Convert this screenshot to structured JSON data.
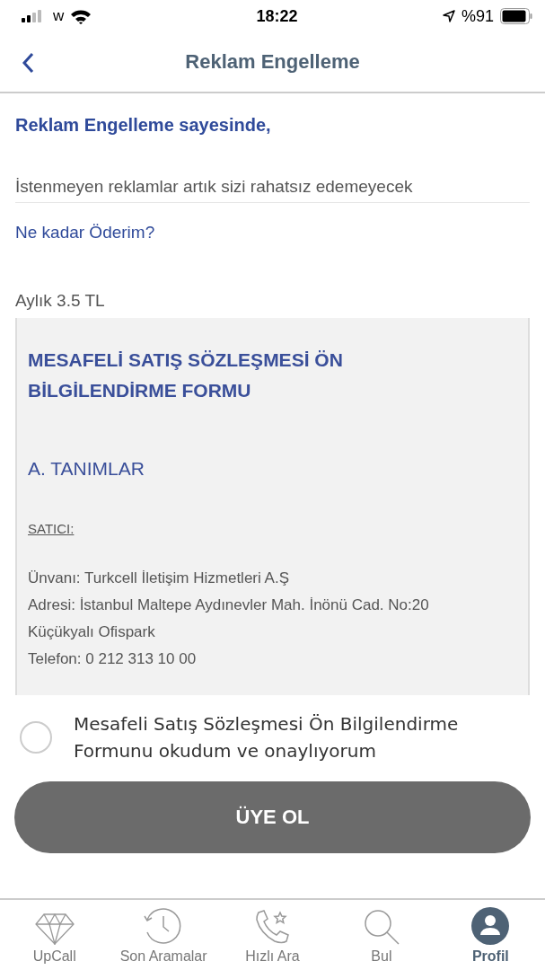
{
  "status_bar": {
    "carrier": "w",
    "time": "18:22",
    "battery": "%91"
  },
  "nav": {
    "title": "Reklam Engelleme"
  },
  "heading": "Reklam Engelleme sayesinde,",
  "description": "İstenmeyen reklamlar artık sizi rahatsız edemeyecek",
  "price_link": "Ne kadar Öderim?",
  "price": "Aylık 3.5 TL",
  "document": {
    "title": "MESAFELİ SATIŞ SÖZLEŞMESİ ÖN BİLGİLENDİRME FORMU",
    "section": "A. TANIMLAR",
    "label": "SATICI:",
    "lines": [
      "Ünvanı: Turkcell İletişim Hizmetleri A.Ş",
      "Adresi: İstanbul Maltepe Aydınevler Mah. İnönü Cad. No:20",
      "Küçükyalı Ofispark",
      "Telefon: 0 212 313 10 00"
    ]
  },
  "consent": {
    "label": "Mesafeli Satış Sözleşmesi Ön Bilgilendirme Formunu okudum ve onaylıyorum",
    "checked": false
  },
  "submit_button": {
    "label": "ÜYE OL",
    "disabled": true
  },
  "tab_bar": [
    {
      "label": "UpCall",
      "kind": "diamond",
      "selected": false
    },
    {
      "label": "Son Aramalar",
      "kind": "history",
      "selected": false
    },
    {
      "label": "Hızlı Ara",
      "kind": "phone",
      "selected": false
    },
    {
      "label": "Bul",
      "kind": "search",
      "selected": false
    },
    {
      "label": "Profil",
      "kind": "profile",
      "selected": true
    }
  ]
}
